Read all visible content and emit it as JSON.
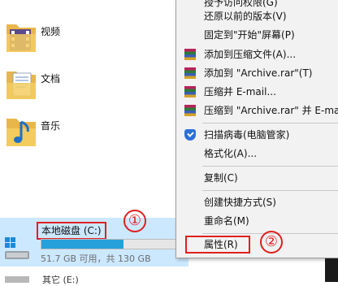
{
  "explorer": {
    "folders": [
      {
        "label": "视频",
        "icon": "videos-folder-icon"
      },
      {
        "label": "文档",
        "icon": "documents-folder-icon"
      },
      {
        "label": "音乐",
        "icon": "music-folder-icon"
      }
    ],
    "drive": {
      "name": "本地磁盘 (C:)",
      "free_text": "51.7 GB 可用，共 130 GB",
      "used_fraction": 0.6
    },
    "next_drive_name": "其它 (E:)"
  },
  "annotations": {
    "circle_1": "①",
    "circle_2": "②"
  },
  "context_menu": {
    "partial_top": "授予访问权限(G)",
    "items": [
      {
        "label": "还原以前的版本(V)"
      },
      {
        "label": "固定到\"开始\"屏幕(P)"
      },
      {
        "label": "添加到压缩文件(A)..."
      },
      {
        "label": "添加到 \"Archive.rar\"(T)"
      },
      {
        "label": "压缩并 E-mail..."
      },
      {
        "label": "压缩到 \"Archive.rar\" 并 E-mail"
      },
      {
        "label": "扫描病毒(电脑管家)"
      },
      {
        "label": "格式化(A)..."
      },
      {
        "label": "复制(C)"
      },
      {
        "label": "创建快捷方式(S)"
      },
      {
        "label": "重命名(M)"
      },
      {
        "label": "属性(R)"
      }
    ]
  },
  "colors": {
    "annotation_red": "#e0201f",
    "selection_blue": "#cce8ff",
    "drive_bar_blue": "#26a0da"
  }
}
